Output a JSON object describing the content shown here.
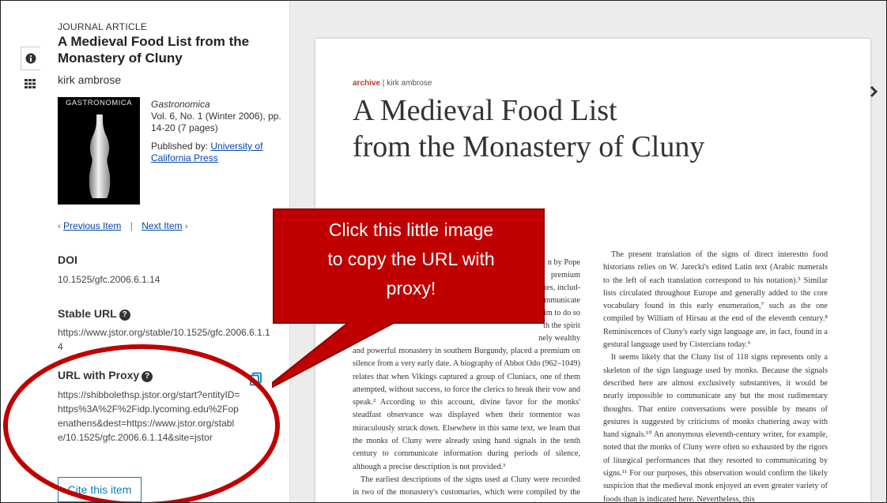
{
  "sidebar": {
    "content_type": "JOURNAL ARTICLE",
    "title": "A Medieval Food List from the Monastery of Cluny",
    "author": "kirk ambrose",
    "cover_text": "GASTRONOMICA",
    "journal_name": "Gastronomica",
    "journal_issue": "Vol. 6, No. 1 (Winter 2006), pp. 14-20 (7 pages)",
    "published_by_label": "Published by: ",
    "publisher": "University of California Press",
    "previous_item": "Previous Item",
    "pager_separator": "|",
    "next_item": "Next Item",
    "doi_label": "DOI",
    "doi_value": "10.1525/gfc.2006.6.1.14",
    "stable_url_label": "Stable URL",
    "stable_url_value": "https://www.jstor.org/stable/10.1525/gfc.2006.6.1.14",
    "proxy_url_label": "URL with Proxy",
    "proxy_url_value": "https://shibbolethsp.jstor.org/start?entityID=https%3A%2F%2Fidp.lycoming.edu%2Fopenathens&dest=https://www.jstor.org/stable/10.1525/gfc.2006.6.1.14&site=jstor",
    "cite_button": "Cite this item"
  },
  "icons": [
    "info-icon",
    "grid-icon",
    "copy-icon",
    "question-icon",
    "chevron-left-icon",
    "chevron-right-icon"
  ],
  "document": {
    "kicker_section": "archive",
    "kicker_sep": " | ",
    "kicker_author": "kirk ambrose",
    "title_line1": "A Medieval Food List",
    "title_line2": "from the Monastery of Cluny",
    "col1_text1": "n by Pope",
    "col1_text2": "premium",
    "col1_text3": "mes, includ-",
    "col1_text4": "mmunicate",
    "col1_text5": "him to do so",
    "col1_text6": "th the spirit",
    "col1_text7": "nely wealthy",
    "col1_para1": "and powerful monastery in southern Burgundy, placed a premium on silence from a very early date. A biography of Abbot Odo (962–1049) relates that when Vikings captured a group of Cluniacs, one of them attempted, without success, to force the clerics to break their vow and speak.² According to this account, divine favor for the monks' steadfast observance was displayed when their tormentor was miraculously struck down. Elsewhere in this same text, we learn that the monks of Cluny were already using hand signals in the tenth century to communicate information during periods of silence, although a precise description is not provided.³",
    "col1_para2": "The earliest descriptions of the signs used at Cluny were recorded in two of the monastery's customaries, which were compiled by the monks Ulrich and Bernard during the last quarter of the eleventh century.⁴ A host of signals",
    "col2_para1": "The present translation of the signs of direct interestto food historians relies on W. Jarecki's edited Latin text (Arabic numerals to the left of each translation correspond to his notation).⁵ Similar lists circulated throughout Europe and generally added to the core vocabulary found in this early enumeration,⁷ such as the one compiled by William of Hirsau at the end of the eleventh century.⁸ Reminiscences of Cluny's early sign language are, in fact, found in a gestural language used by Cistercians today.⁹",
    "col2_para2": "It seems likely that the Cluny list of 118 signs represents only a skeleton of the sign language used by monks. Because the signals described here are almost exclusively substantives, it would be nearly impossible to communicate any but the most rudimentary thoughts. That entire conversations were possible by means of gestures is suggested by criticisms of monks chattering away with hand signals.¹⁰ An anonymous eleventh-century writer, for example, noted that the monks of Cluny were often so exhausted by the rigors of liturgical performances that they resorted to communicating by signs.¹¹ For our purposes, this observation would confirm the likely suspicion that the medieval monk enjoyed an even greater variety of foods than is indicated here. Nevertheless, this"
  },
  "callout": {
    "line1": "Click this little image",
    "line2": "to copy the URL with",
    "line3": "proxy!",
    "color": "#c00000",
    "ring_color": "#c00000"
  }
}
